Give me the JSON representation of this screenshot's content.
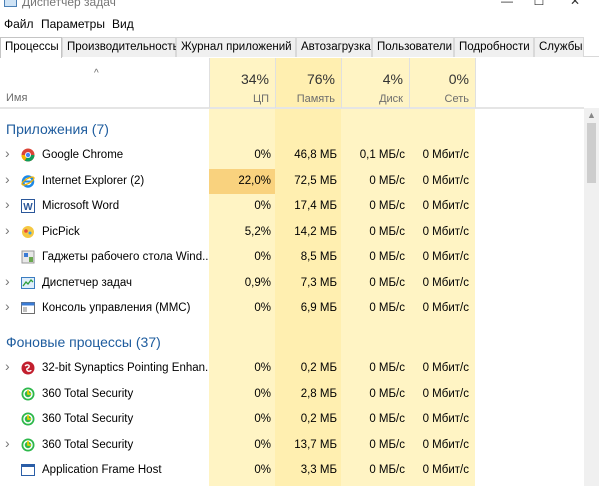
{
  "window": {
    "title": "Диспетчер задач"
  },
  "menu": [
    "Файл",
    "Параметры",
    "Вид"
  ],
  "tabs": [
    "Процессы",
    "Производительность",
    "Журнал приложений",
    "Автозагрузка",
    "Пользователи",
    "Подробности",
    "Службы"
  ],
  "columns": {
    "name": "Имя",
    "cpu": {
      "percent": "34%",
      "label": "ЦП"
    },
    "memory": {
      "percent": "76%",
      "label": "Память"
    },
    "disk": {
      "percent": "4%",
      "label": "Диск"
    },
    "network": {
      "percent": "0%",
      "label": "Сеть"
    }
  },
  "groups": {
    "apps": {
      "title": "Приложения (7)",
      "rows": [
        {
          "name": "Google Chrome",
          "cpu": "0%",
          "mem": "46,8 МБ",
          "disk": "0,1 МБ/с",
          "net": "0 Мбит/с",
          "icon": "chrome-icon",
          "expandable": true
        },
        {
          "name": "Internet Explorer (2)",
          "cpu": "22,0%",
          "mem": "72,5 МБ",
          "disk": "0 МБ/с",
          "net": "0 Мбит/с",
          "icon": "ie-icon",
          "expandable": true
        },
        {
          "name": "Microsoft Word",
          "cpu": "0%",
          "mem": "17,4 МБ",
          "disk": "0 МБ/с",
          "net": "0 Мбит/с",
          "icon": "word-icon",
          "expandable": true
        },
        {
          "name": "PicPick",
          "cpu": "5,2%",
          "mem": "14,2 МБ",
          "disk": "0 МБ/с",
          "net": "0 Мбит/с",
          "icon": "picpick-icon",
          "expandable": true
        },
        {
          "name": "Гаджеты рабочего стола Wind...",
          "cpu": "0%",
          "mem": "8,5 МБ",
          "disk": "0 МБ/с",
          "net": "0 Мбит/с",
          "icon": "gadgets-icon",
          "expandable": false
        },
        {
          "name": "Диспетчер задач",
          "cpu": "0,9%",
          "mem": "7,3 МБ",
          "disk": "0 МБ/с",
          "net": "0 Мбит/с",
          "icon": "task-manager-icon",
          "expandable": true
        },
        {
          "name": "Консоль управления (MMC)",
          "cpu": "0%",
          "mem": "6,9 МБ",
          "disk": "0 МБ/с",
          "net": "0 Мбит/с",
          "icon": "mmc-icon",
          "expandable": true
        }
      ]
    },
    "background": {
      "title": "Фоновые процессы (37)",
      "rows": [
        {
          "name": "32-bit Synaptics Pointing Enhan...",
          "cpu": "0%",
          "mem": "0,2 МБ",
          "disk": "0 МБ/с",
          "net": "0 Мбит/с",
          "icon": "synaptics-icon",
          "expandable": true
        },
        {
          "name": "360 Total Security",
          "cpu": "0%",
          "mem": "2,8 МБ",
          "disk": "0 МБ/с",
          "net": "0 Мбит/с",
          "icon": "360-security-icon",
          "expandable": false
        },
        {
          "name": "360 Total Security",
          "cpu": "0%",
          "mem": "0,2 МБ",
          "disk": "0 МБ/с",
          "net": "0 Мбит/с",
          "icon": "360-security-icon",
          "expandable": false
        },
        {
          "name": "360 Total Security",
          "cpu": "0%",
          "mem": "13,7 МБ",
          "disk": "0 МБ/с",
          "net": "0 Мбит/с",
          "icon": "360-security-icon",
          "expandable": true
        },
        {
          "name": "Application Frame Host",
          "cpu": "0%",
          "mem": "3,3 МБ",
          "disk": "0 МБ/с",
          "net": "0 Мбит/с",
          "icon": "app-frame-icon",
          "expandable": false
        }
      ]
    }
  },
  "colors": {
    "group_title": "#1e5c9e",
    "cpu_col_bg": "#fff4c4",
    "mem_col_bg": "#ffefb0",
    "disk_col_bg": "#fff4c4",
    "net_col_bg": "#fff4c4",
    "cpu_high_bg": "#f9d27e"
  }
}
